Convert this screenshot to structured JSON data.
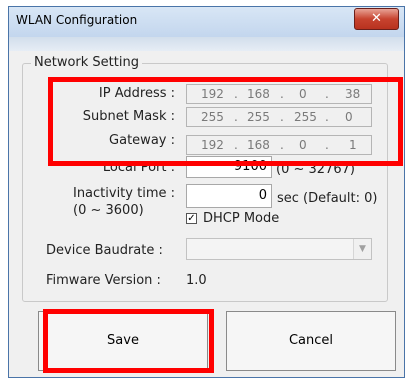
{
  "window": {
    "title": "WLAN Configuration",
    "close_glyph": "✕"
  },
  "group": {
    "label": "Network Setting"
  },
  "ip_address": {
    "label": "IP Address :",
    "octets": [
      "192",
      "168",
      "0",
      "38"
    ]
  },
  "subnet_mask": {
    "label": "Subnet Mask :",
    "octets": [
      "255",
      "255",
      "255",
      "0"
    ]
  },
  "gateway": {
    "label": "Gateway :",
    "octets": [
      "192",
      "168",
      "0",
      "1"
    ]
  },
  "local_port": {
    "label": "Local Port :",
    "value": "9100",
    "range": "(0 ~ 32767)"
  },
  "inactivity": {
    "label": "Inactivity time :",
    "range": "(0 ~ 3600)",
    "value": "0",
    "suffix": "sec (Default: 0)"
  },
  "dhcp": {
    "label": "DHCP Mode",
    "checked": true,
    "check_glyph": "✓"
  },
  "baudrate": {
    "label": "Device Baudrate :",
    "value": "",
    "arrow_glyph": "▼"
  },
  "firmware": {
    "label": "Fimware Version :",
    "value": "1.0"
  },
  "buttons": {
    "save": "Save",
    "cancel": "Cancel"
  },
  "highlight_color": "#ff0000"
}
